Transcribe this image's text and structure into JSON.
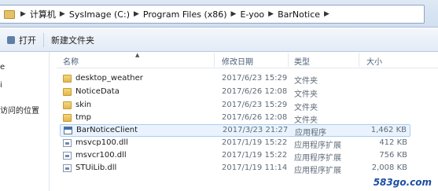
{
  "address_bar": {
    "crumbs": [
      "计算机",
      "SysImage (C:)",
      "Program Files (x86)",
      "E-yoo",
      "BarNotice"
    ]
  },
  "toolbar": {
    "open_label": "打开",
    "new_folder_label": "新建文件夹"
  },
  "nav": {
    "items": [
      "e",
      "i",
      "访问的位置"
    ]
  },
  "columns": {
    "name": "名称",
    "date": "修改日期",
    "type": "类型",
    "size": "大小"
  },
  "files": [
    {
      "name": "desktop_weather",
      "date": "2017/6/23 15:29",
      "type": "文件夹",
      "size": "",
      "icon": "folder-icon"
    },
    {
      "name": "NoticeData",
      "date": "2017/6/26 12:08",
      "type": "文件夹",
      "size": "",
      "icon": "folder-icon"
    },
    {
      "name": "skin",
      "date": "2017/6/23 15:29",
      "type": "文件夹",
      "size": "",
      "icon": "folder-icon"
    },
    {
      "name": "tmp",
      "date": "2017/6/26 12:08",
      "type": "文件夹",
      "size": "",
      "icon": "folder-icon"
    },
    {
      "name": "BarNoticeClient",
      "date": "2017/3/23 21:27",
      "type": "应用程序",
      "size": "1,462 KB",
      "icon": "exe-icon"
    },
    {
      "name": "msvcp100.dll",
      "date": "2017/1/19 15:22",
      "type": "应用程序扩展",
      "size": "412 KB",
      "icon": "dll-icon"
    },
    {
      "name": "msvcr100.dll",
      "date": "2017/1/19 15:22",
      "type": "应用程序扩展",
      "size": "756 KB",
      "icon": "dll-icon"
    },
    {
      "name": "STUiLib.dll",
      "date": "2017/1/19 11:14",
      "type": "应用程序扩展",
      "size": "2,008 KB",
      "icon": "dll-icon"
    }
  ],
  "watermark": "583go.com"
}
